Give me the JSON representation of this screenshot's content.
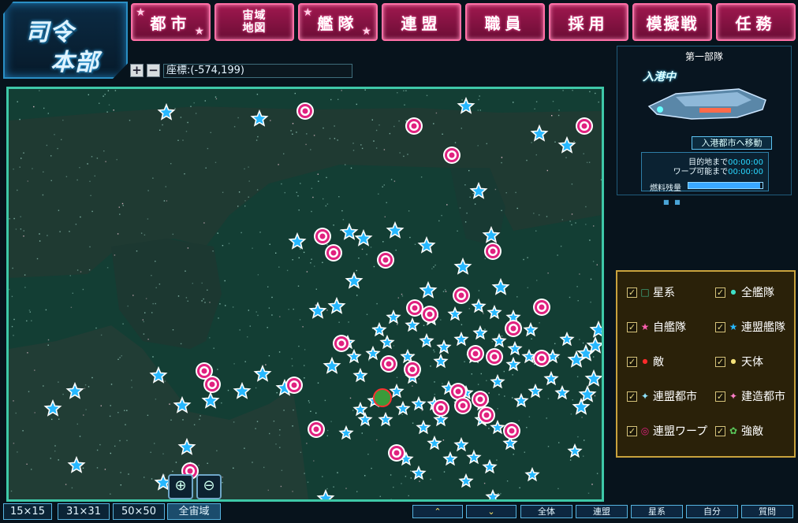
{
  "logo": {
    "line1": "司令",
    "line2": "本部"
  },
  "nav": [
    {
      "label": "都市",
      "small": false
    },
    {
      "label": "宙域\n地図",
      "small": true
    },
    {
      "label": "艦隊",
      "small": false
    },
    {
      "label": "連盟",
      "small": false
    },
    {
      "label": "職員",
      "small": false
    },
    {
      "label": "採用",
      "small": false
    },
    {
      "label": "模擬戦",
      "small": false
    },
    {
      "label": "任務",
      "small": false
    }
  ],
  "coords": {
    "plus": "+",
    "minus": "−",
    "text": "座標:(-574,199)"
  },
  "fleet": {
    "header": "第一部隊",
    "status": "入港中",
    "move_button": "入港都市へ移動",
    "arrival_label": "目的地まで",
    "arrival_value": "00:00:00",
    "warp_label": "ワープ可能まで",
    "warp_value": "00:00:00",
    "fuel_label": "燃料残量",
    "fuel_fraction": 0.97,
    "page_dots": "■ ■"
  },
  "legend": [
    {
      "label": "星系",
      "icon": "square-outline-icon",
      "color": "#3fb28a"
    },
    {
      "label": "全艦隊",
      "icon": "dot-icon",
      "color": "#3fe0c8"
    },
    {
      "label": "自艦隊",
      "icon": "star-icon",
      "color": "#ff5fb0"
    },
    {
      "label": "連盟艦隊",
      "icon": "star-icon",
      "color": "#27b8ff"
    },
    {
      "label": "敵",
      "icon": "dot-icon",
      "color": "#ff2b2b"
    },
    {
      "label": "天体",
      "icon": "dot-icon",
      "color": "#f4e27a"
    },
    {
      "label": "連盟都市",
      "icon": "sparkle-icon",
      "color": "#8fe3ff"
    },
    {
      "label": "建造都市",
      "icon": "sparkle-icon",
      "color": "#ff7fc8"
    },
    {
      "label": "連盟ワープ",
      "icon": "target-icon",
      "color": "#e0217f"
    },
    {
      "label": "強敵",
      "icon": "monster-icon",
      "color": "#5ac85a"
    }
  ],
  "scale_buttons": [
    {
      "label": "15×15"
    },
    {
      "label": "31×31"
    },
    {
      "label": "50×50"
    },
    {
      "label": "全宙域"
    }
  ],
  "filter_buttons": [
    {
      "label": "全体"
    },
    {
      "label": "連盟"
    },
    {
      "label": "星系"
    },
    {
      "label": "自分"
    },
    {
      "label": "質問"
    }
  ],
  "arrows": {
    "up": "⌃",
    "down": "⌄"
  },
  "colors": {
    "accent_pink": "#ff5da0",
    "accent_cyan": "#3ec8a8",
    "star_blue": "#27b8ff",
    "warp_pink": "#e0217f"
  }
}
